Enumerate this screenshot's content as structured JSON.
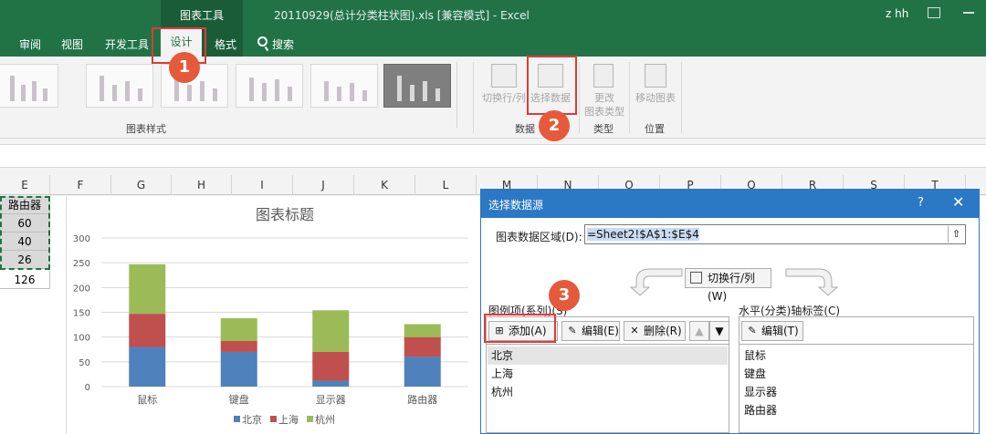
{
  "titlebar": {
    "context_label": "图表工具",
    "title": "20110929(总计分类柱状图).xls  [兼容模式]  -  Excel",
    "user": "z hh"
  },
  "tabs": [
    "审阅",
    "视图",
    "开发工具",
    "设计",
    "格式",
    "搜索"
  ],
  "ribbon": {
    "group_styles": "图表样式",
    "btn_switch_row_col": "切换行/列",
    "btn_select_data": "选择数据",
    "btn_change_type_1": "更改",
    "btn_change_type_2": "图表类型",
    "btn_move_chart": "移动图表",
    "group_data": "数据",
    "group_type": "类型",
    "group_location": "位置"
  },
  "columns": [
    "E",
    "F",
    "G",
    "H",
    "I",
    "J",
    "K",
    "L",
    "M",
    "N",
    "O",
    "P",
    "Q",
    "R",
    "S",
    "T"
  ],
  "cells": [
    "路由器",
    "60",
    "40",
    "26",
    "126"
  ],
  "chart_data": {
    "type": "bar",
    "stacked": true,
    "title": "图表标题",
    "categories": [
      "鼠标",
      "键盘",
      "显示器",
      "路由器"
    ],
    "series": [
      {
        "name": "北京",
        "values": [
          80,
          70,
          12,
          60
        ],
        "color": "#4f81bd"
      },
      {
        "name": "上海",
        "values": [
          67,
          22,
          58,
          40
        ],
        "color": "#c0504d"
      },
      {
        "name": "杭州",
        "values": [
          100,
          46,
          84,
          26
        ],
        "color": "#9bbb59"
      }
    ],
    "ylim": [
      0,
      300
    ],
    "yticks": [
      "0",
      "50",
      "100",
      "150",
      "200",
      "250",
      "300"
    ],
    "grid": true,
    "legend": "bottom"
  },
  "dialog": {
    "title": "选择数据源",
    "help": "?",
    "close": "✕",
    "range_label": "图表数据区域(D):",
    "range_value": "=Sheet2!$A$1:$E$4",
    "switch_button": "切换行/列(W)",
    "legend_label": "图例项(系列)(S)",
    "axis_label": "水平(分类)轴标签(C)",
    "add": "添加(A)",
    "edit": "编辑(E)",
    "delete": "删除(R)",
    "axis_edit": "编辑(T)",
    "series_items": [
      "北京",
      "上海",
      "杭州"
    ],
    "axis_items": [
      "鼠标",
      "键盘",
      "显示器",
      "路由器"
    ]
  },
  "callouts": [
    "1",
    "2",
    "3"
  ],
  "colors": {
    "excel_green": "#217346",
    "dialog_blue": "#2b78c5",
    "callout_red": "#e45a3a"
  }
}
